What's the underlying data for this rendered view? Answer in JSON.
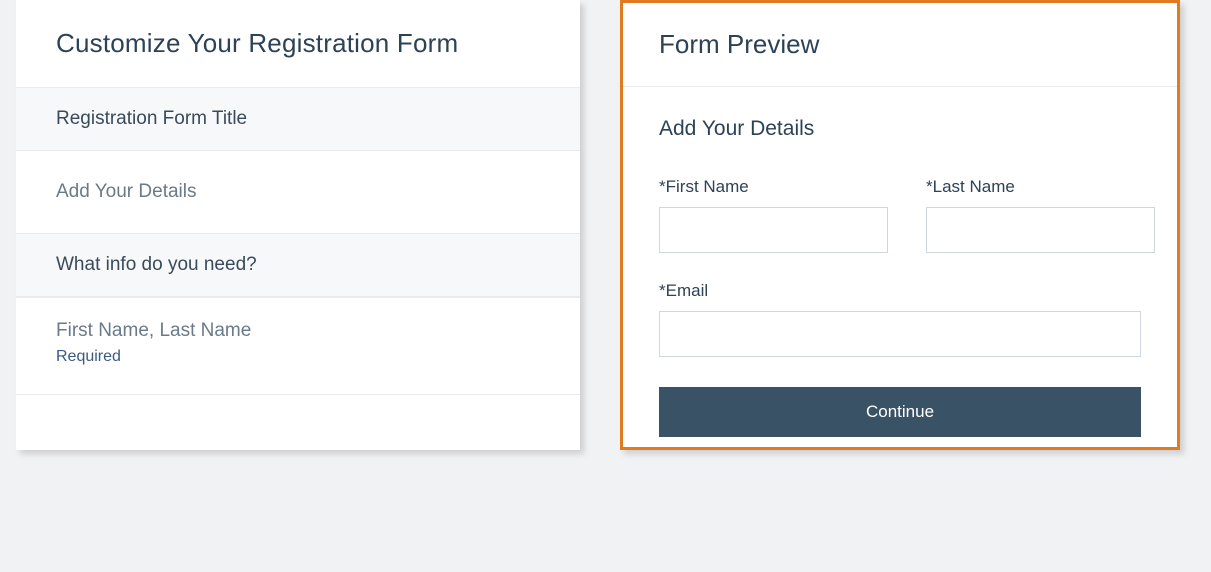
{
  "left": {
    "header": "Customize Your Registration Form",
    "sections": {
      "titleLabel": "Registration Form Title",
      "titleValue": "Add Your Details",
      "infoLabel": "What info do you need?",
      "fieldNames": "First Name, Last Name",
      "fieldNote": "Required"
    }
  },
  "right": {
    "header": "Form Preview",
    "previewTitle": "Add Your Details",
    "fields": {
      "firstName": "*First Name",
      "lastName": "*Last Name",
      "email": "*Email"
    },
    "continue": "Continue"
  }
}
